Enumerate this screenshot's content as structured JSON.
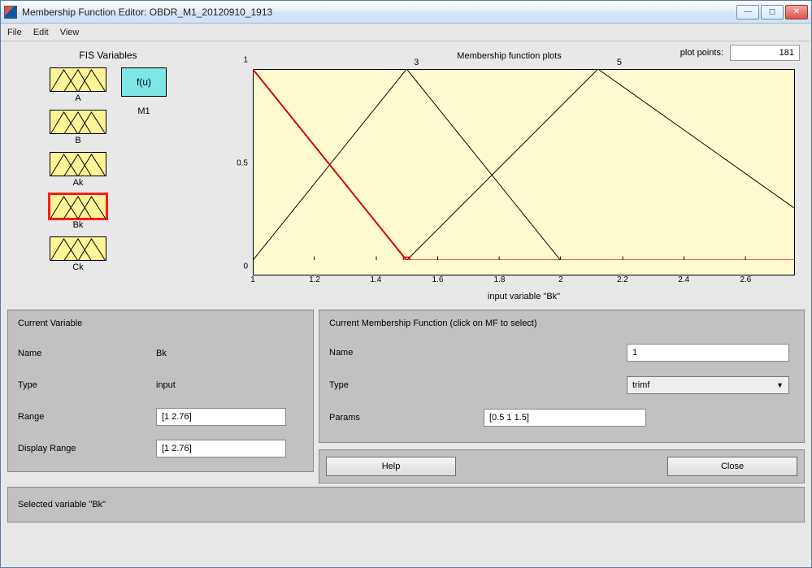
{
  "window": {
    "title": "Membership Function Editor: OBDR_M1_20120910_1913"
  },
  "menu": {
    "file": "File",
    "edit": "Edit",
    "view": "View"
  },
  "fis": {
    "title": "FIS Variables",
    "vars": [
      "A",
      "B",
      "Ak",
      "Bk",
      "Ck"
    ],
    "selected": "Bk",
    "output_label": "f(u)",
    "output_name": "M1"
  },
  "plot": {
    "title": "Membership function plots",
    "points_label": "plot points:",
    "points_value": "181",
    "xlabel": "input variable \"Bk\"",
    "annotations": {
      "a3": "3",
      "a5": "5"
    }
  },
  "chart_data": {
    "type": "line",
    "xlabel": "input variable \"Bk\"",
    "ylabel": "",
    "xlim": [
      1,
      2.76
    ],
    "ylim": [
      0,
      1
    ],
    "x_ticks": [
      1,
      1.2,
      1.4,
      1.6,
      1.8,
      2,
      2.2,
      2.4,
      2.6
    ],
    "y_ticks": [
      0,
      0.5,
      1
    ],
    "series": [
      {
        "name": "1",
        "type": "trimf",
        "params": [
          0.5,
          1,
          1.5
        ],
        "selected": true,
        "points": [
          [
            1,
            1
          ],
          [
            1.5,
            0
          ],
          [
            2.76,
            0
          ]
        ]
      },
      {
        "name": "3",
        "type": "trimf",
        "params": [
          1,
          1.5,
          2
        ],
        "points": [
          [
            1,
            0
          ],
          [
            1.5,
            1
          ],
          [
            2,
            0
          ]
        ]
      },
      {
        "name": "5",
        "type": "trimf",
        "params": [
          1.5,
          2.12,
          2.76
        ],
        "points": [
          [
            1.5,
            0
          ],
          [
            2.12,
            1
          ],
          [
            2.76,
            0.27
          ]
        ]
      }
    ]
  },
  "current_variable": {
    "panel_title": "Current Variable",
    "labels": {
      "name": "Name",
      "type": "Type",
      "range": "Range",
      "display_range": "Display Range"
    },
    "name": "Bk",
    "type": "input",
    "range": "[1 2.76]",
    "display_range": "[1 2.76]"
  },
  "current_mf": {
    "panel_title": "Current Membership Function (click on MF to select)",
    "labels": {
      "name": "Name",
      "type": "Type",
      "params": "Params"
    },
    "name": "1",
    "type": "trimf",
    "params": "[0.5 1 1.5]"
  },
  "buttons": {
    "help": "Help",
    "close": "Close"
  },
  "status": "Selected variable \"Bk\""
}
